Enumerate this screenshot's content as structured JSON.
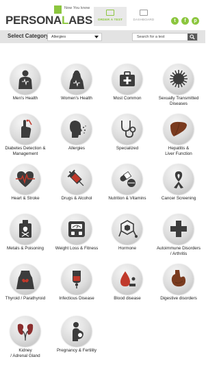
{
  "header": {
    "logo_tagline": "Now You know",
    "logo_text_a": "PERSONA",
    "logo_text_b": "L",
    "logo_text_c": "ABS",
    "tabs": [
      {
        "label": "ORDER A TEST",
        "active": true
      },
      {
        "label": "DASHBOARD",
        "active": false
      }
    ],
    "social": [
      {
        "icon": "twitter-icon",
        "glyph": "t"
      },
      {
        "icon": "facebook-icon",
        "glyph": "f"
      },
      {
        "icon": "pinterest-icon",
        "glyph": "p"
      }
    ]
  },
  "category_bar": {
    "label": "Select Category",
    "selected": "Allergies",
    "search_placeholder": "Search for a test"
  },
  "colors": {
    "accent": "#8cc63f",
    "icon_dark": "#3c3c3c",
    "bar_bg": "#e3e3e3"
  },
  "categories": [
    {
      "label": "Men's Health",
      "icon": "male-figure-icon"
    },
    {
      "label": "Women's Health",
      "icon": "female-figure-icon"
    },
    {
      "label": "Most Common",
      "icon": "medical-bag-icon"
    },
    {
      "label": "Sexually Transmitted\nDiseases",
      "icon": "virus-icon"
    },
    {
      "label": "Diabetes Detection &\nManagement",
      "icon": "finger-prick-icon"
    },
    {
      "label": "Allergies",
      "icon": "sneeze-face-icon"
    },
    {
      "label": "Specialized",
      "icon": "stethoscope-icon"
    },
    {
      "label": "Hepatitis &\nLiver Function",
      "icon": "liver-icon"
    },
    {
      "label": "Heart & Stroke",
      "icon": "heartbeat-icon"
    },
    {
      "label": "Drugs & Alcohol",
      "icon": "syringe-icon"
    },
    {
      "label": "Nutrition & Vitamins",
      "icon": "pills-icon"
    },
    {
      "label": "Cancer Screening",
      "icon": "ribbon-icon"
    },
    {
      "label": "Metals & Poisoning",
      "icon": "poison-bottle-icon"
    },
    {
      "label": "Weight Loss & Fitness",
      "icon": "scale-icon"
    },
    {
      "label": "Hormone",
      "icon": "molecule-icon"
    },
    {
      "label": "Autoimmune Disorders\n/ Arthritis",
      "icon": "cross-icon"
    },
    {
      "label": "Thyroid / Parathyroid",
      "icon": "thyroid-icon"
    },
    {
      "label": "Infectious Disease",
      "icon": "iv-bag-icon"
    },
    {
      "label": "Blood disease",
      "icon": "blood-drop-icon"
    },
    {
      "label": "Digestive disorders",
      "icon": "stomach-icon"
    },
    {
      "label": "Kidney\n/ Adrenal Gland",
      "icon": "kidney-icon"
    },
    {
      "label": "Pregnancy & Fertility",
      "icon": "pregnancy-icon"
    }
  ]
}
